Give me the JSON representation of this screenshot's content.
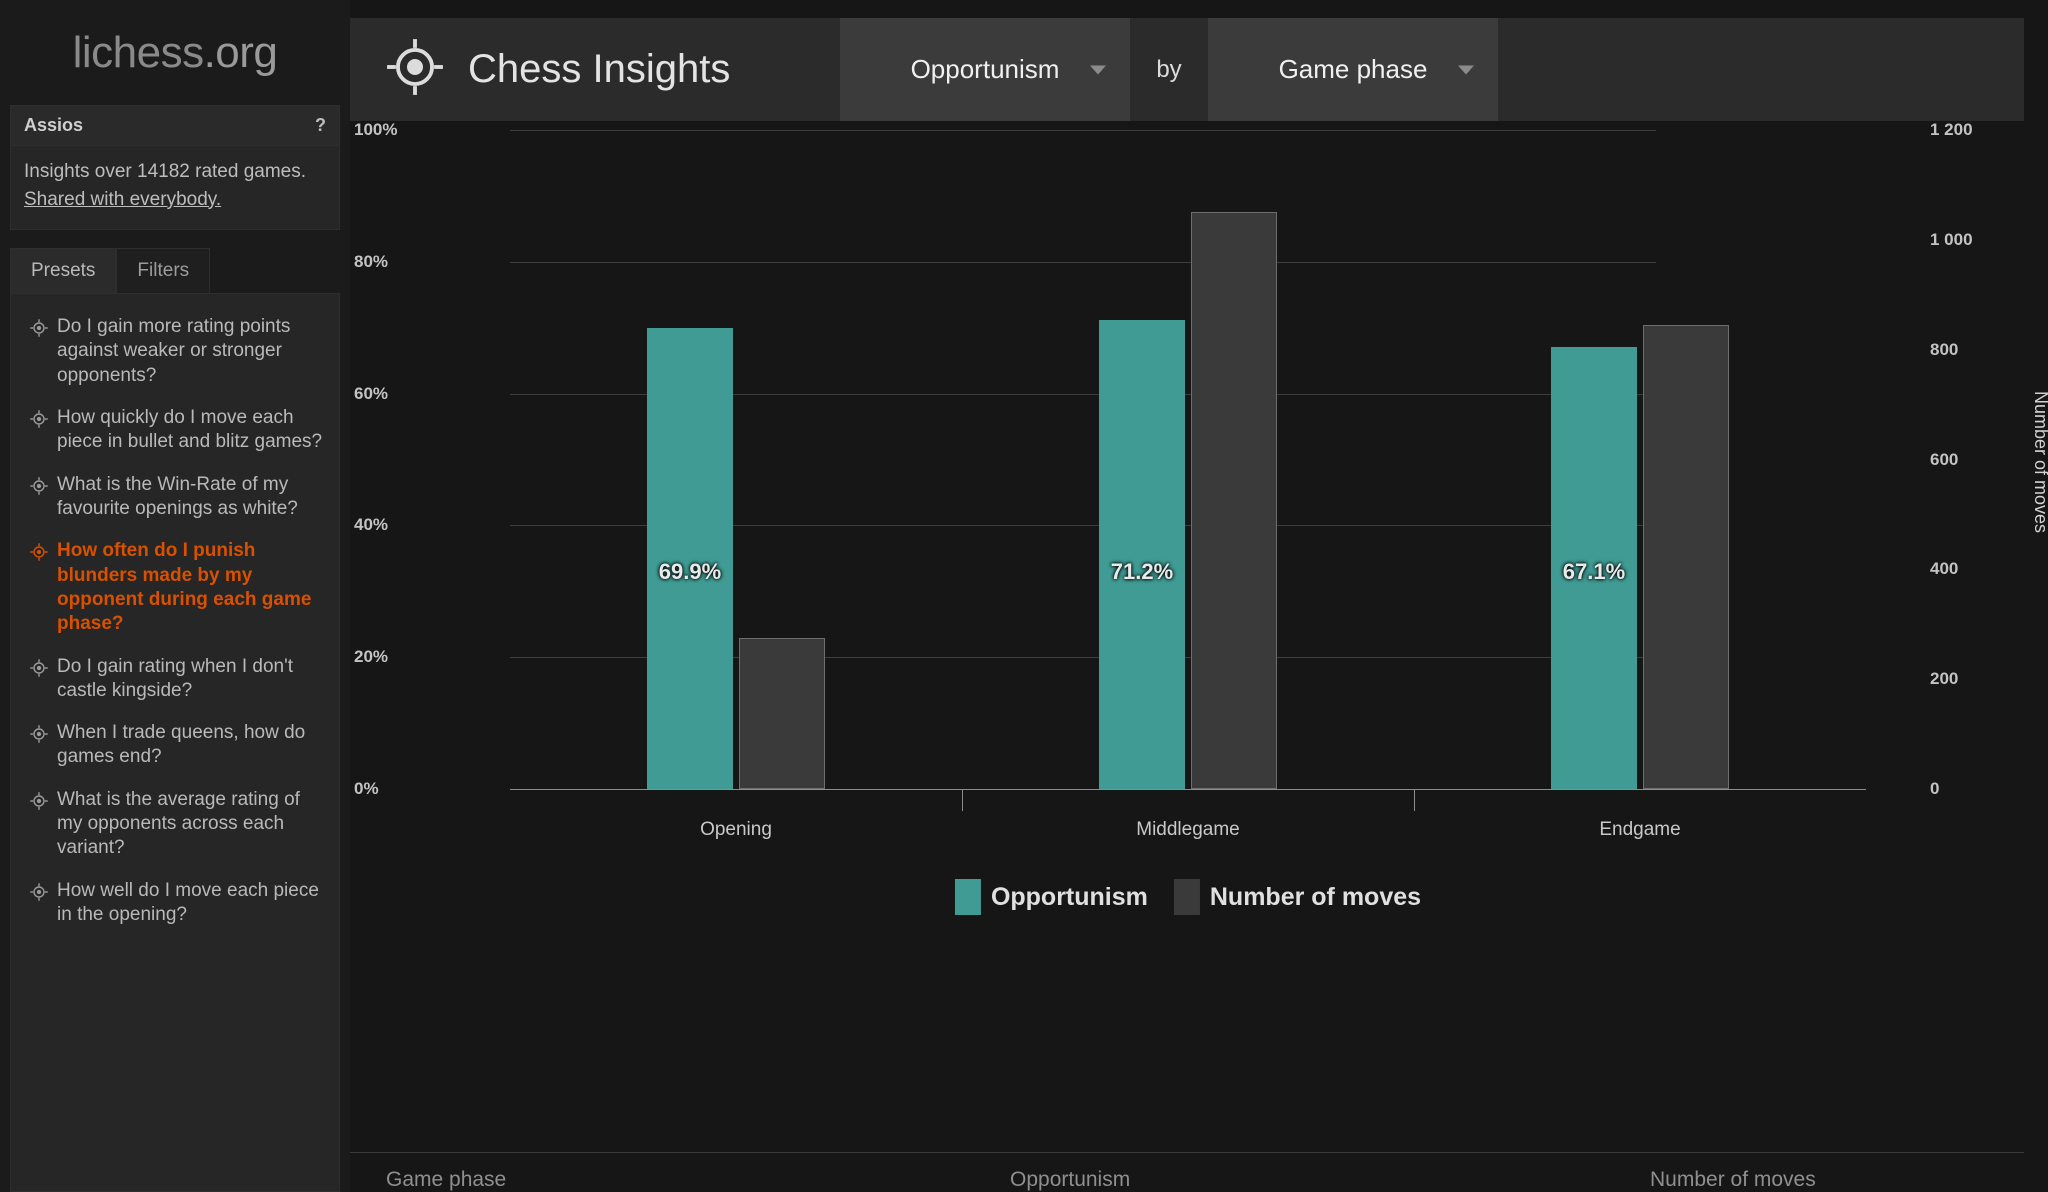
{
  "brand": {
    "name": "lichess",
    "tld": ".org"
  },
  "sidebar": {
    "user": {
      "name": "Assios",
      "help": "?"
    },
    "info": {
      "line1": "Insights over 14182 rated games.",
      "line2": "Shared with everybody."
    },
    "tabs": [
      {
        "label": "Presets",
        "active": true
      },
      {
        "label": "Filters",
        "active": false
      }
    ],
    "presets": [
      {
        "label": "Do I gain more rating points against weaker or stronger opponents?",
        "active": false
      },
      {
        "label": "How quickly do I move each piece in bullet and blitz games?",
        "active": false
      },
      {
        "label": "What is the Win-Rate of my favourite openings as white?",
        "active": false
      },
      {
        "label": "How often do I punish blunders made by my opponent during each game phase?",
        "active": true
      },
      {
        "label": "Do I gain rating when I don't castle kingside?",
        "active": false
      },
      {
        "label": "When I trade queens, how do games end?",
        "active": false
      },
      {
        "label": "What is the average rating of my opponents across each variant?",
        "active": false
      },
      {
        "label": "How well do I move each piece in the opening?",
        "active": false
      }
    ]
  },
  "header": {
    "title": "Chess Insights",
    "metric_select": "Opportunism",
    "by_word": "by",
    "dimension_select": "Game phase"
  },
  "table": {
    "columns": [
      "Game phase",
      "Opportunism",
      "Number of moves"
    ]
  },
  "colors": {
    "accent_teal": "#3f9b93",
    "accent_orange": "#d85000",
    "bar_gray": "#3a3a3a",
    "panel": "#262626",
    "background": "#161616"
  },
  "chart_data": {
    "type": "bar",
    "title": "Opportunism by Game phase",
    "categories": [
      "Opening",
      "Middlegame",
      "Endgame"
    ],
    "series": [
      {
        "name": "Opportunism",
        "unit": "%",
        "axis": "left",
        "values": [
          69.9,
          71.2,
          67.1
        ],
        "labels": [
          "69.9%",
          "71.2%",
          "67.1%"
        ]
      },
      {
        "name": "Number of moves",
        "unit": "moves",
        "axis": "right",
        "values": [
          275,
          1050,
          845
        ],
        "labels": [
          "",
          "",
          ""
        ]
      }
    ],
    "left_axis": {
      "label": "",
      "ticks": [
        "0%",
        "20%",
        "40%",
        "60%",
        "80%",
        "100%"
      ],
      "ticks_num": [
        0,
        20,
        40,
        60,
        80,
        100
      ],
      "min": 0,
      "max": 100
    },
    "right_axis": {
      "label": "Number of moves",
      "ticks": [
        "0",
        "200",
        "400",
        "600",
        "800",
        "1 000",
        "1 200"
      ],
      "ticks_num": [
        0,
        200,
        400,
        600,
        800,
        1000,
        1200
      ],
      "min": 0,
      "max": 1200
    },
    "xlabel": "",
    "grid": true,
    "legend": [
      {
        "name": "Opportunism",
        "color": "#3f9b93"
      },
      {
        "name": "Number of moves",
        "color": "#3a3a3a"
      }
    ],
    "legend_position": "bottom"
  }
}
